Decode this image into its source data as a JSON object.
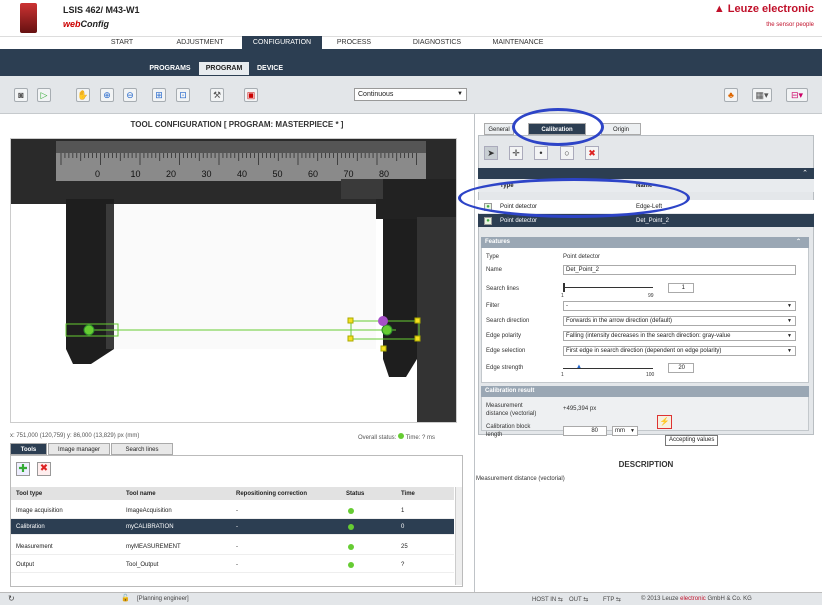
{
  "header": {
    "product": "LSIS 462/ M43-W1",
    "app_web": "web",
    "app_config": "Config",
    "brand": "Leuze electronic",
    "brand_symbol": "▲",
    "tagline": "the sensor people"
  },
  "menu": [
    "START",
    "ADJUSTMENT",
    "CONFIGURATION",
    "PROCESS",
    "DIAGNOSTICS",
    "MAINTENANCE"
  ],
  "submenu": [
    "PROGRAMS",
    "PROGRAM",
    "DEVICE"
  ],
  "toolbar": {
    "mode_select": "Continuous"
  },
  "left": {
    "config_title": "TOOL CONFIGURATION   [ PROGRAM: MASTERPIECE * ]",
    "status_coords": "x: 751,000 (120,759) y: 86,000 (13,829) px (mm)",
    "overall_status": "Overall status:",
    "overall_time": "Time: ? ms",
    "tabs": [
      "Tools",
      "Image manager",
      "Search lines"
    ],
    "table_headers": [
      "Tool type",
      "Tool name",
      "Repositioning correction",
      "Status",
      "Time"
    ],
    "rows": [
      {
        "type": "Image acquisition",
        "name": "ImageAcquisition",
        "corr": "-",
        "time": "1"
      },
      {
        "type": "Calibration",
        "name": "myCALIBRATION",
        "corr": "-",
        "time": "0"
      },
      {
        "type": "Measurement",
        "name": "myMEASUREMENT",
        "corr": "-",
        "time": "25"
      },
      {
        "type": "Output",
        "name": "Tool_Output",
        "corr": "-",
        "time": "?"
      }
    ],
    "ruler_numbers": [
      "0",
      "10",
      "20",
      "30",
      "40",
      "50",
      "60",
      "70",
      "80"
    ]
  },
  "right": {
    "tabs": [
      "General",
      "Calibration",
      "Origin"
    ],
    "list_headers": [
      "Type",
      "Name"
    ],
    "list_rows": [
      {
        "type": "Point detector",
        "name": "Edge-Left"
      },
      {
        "type": "Point detector",
        "name": "Det_Point_2"
      }
    ],
    "features": {
      "title": "Features",
      "type_label": "Type",
      "type_value": "Point detector",
      "name_label": "Name",
      "name_value": "Det_Point_2",
      "search_lines_label": "Search lines",
      "search_lines_min": "1",
      "search_lines_max": "99",
      "search_lines_value": "1",
      "filter_label": "Filter",
      "filter_value": "-",
      "direction_label": "Search direction",
      "direction_value": "Forwards in the arrow direction (default)",
      "polarity_label": "Edge polarity",
      "polarity_value": "Falling (intensity decreases in the search direction: gray-value",
      "selection_label": "Edge selection",
      "selection_value": "First edge in search direction (dependent on edge polarity)",
      "strength_label": "Edge strength",
      "strength_min": "1",
      "strength_max": "100",
      "strength_value": "20"
    },
    "calibration": {
      "title": "Calibration result",
      "measurement_label_1": "Measurement",
      "measurement_label_2": "distance (vectorial)",
      "measurement_value": "+495,394  px",
      "block_label_1": "Calibration block",
      "block_label_2": "length",
      "block_value": "80",
      "block_unit": "mm",
      "tooltip": "Accepting values"
    },
    "description_title": "DESCRIPTION",
    "description_text": "Measurement distance (vectorial)"
  },
  "footer": {
    "user": "[Planning engineer]",
    "host": "HOST IN",
    "out": "OUT",
    "ftp": "FTP",
    "copyright_pre": "© 2013 Leuze ",
    "copyright_red": "electronic",
    "copyright_post": " GmbH & Co. KG"
  },
  "colors": {
    "navy": "#2c3e52",
    "brand_red": "#c0102a",
    "status_green": "#66cc33",
    "highlight_blue": "#2d44c7"
  }
}
